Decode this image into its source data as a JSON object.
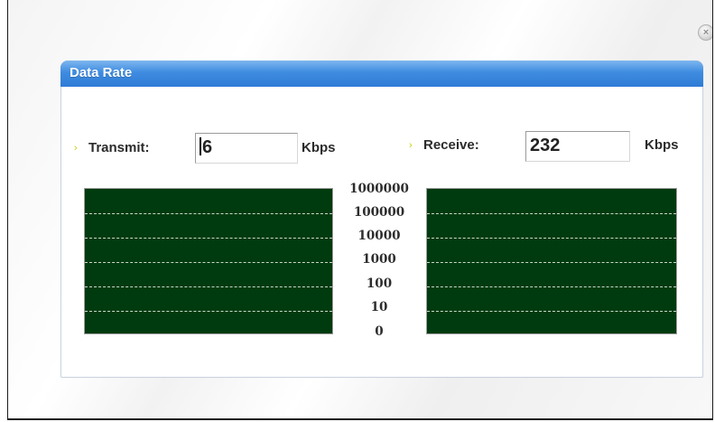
{
  "window": {
    "close_symbol": "×"
  },
  "panel": {
    "title": "Data Rate"
  },
  "transmit": {
    "label": "Transmit:",
    "value": "6",
    "unit": "Kbps",
    "bullet": "›"
  },
  "receive": {
    "label": "Receive:",
    "value": "232",
    "unit": "Kbps",
    "bullet": "›"
  },
  "scale": {
    "labels": [
      "1000000",
      "100000",
      "10000",
      "1000",
      "100",
      "10",
      "0"
    ]
  }
}
